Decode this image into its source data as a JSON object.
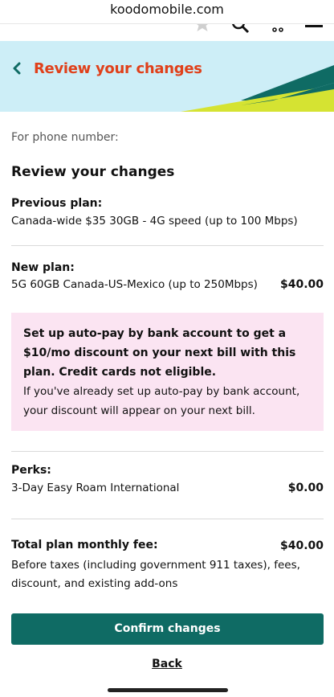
{
  "browser": {
    "url": "koodomobile.com"
  },
  "nav": {
    "icons": [
      "star-icon",
      "search-icon",
      "cart-icon",
      "menu-icon"
    ]
  },
  "header": {
    "title": "Review your changes",
    "back_icon": "chevron-left-icon"
  },
  "phone": {
    "label": "For phone number:"
  },
  "review": {
    "title": "Review your changes"
  },
  "previous_plan": {
    "label": "Previous plan:",
    "description": "Canada-wide $35 30GB - 4G speed (up to 100 Mbps)"
  },
  "new_plan": {
    "label": "New plan:",
    "description": "5G 60GB Canada-US-Mexico (up to 250Mbps)",
    "price": "$40.00"
  },
  "promo": {
    "line1": "Set up auto-pay by bank account to get a",
    "line2": "$10/mo discount on your next bill with this",
    "line3": "plan. Credit cards not eligible.",
    "line4": "If you've already set up auto-pay by bank account,",
    "line5": "your discount will appear on your next bill."
  },
  "perks": {
    "label": "Perks:",
    "item": "3-Day Easy Roam International",
    "price": "$0.00"
  },
  "total": {
    "label": "Total plan monthly fee:",
    "price": "$40.00",
    "note_line1": "Before taxes (including government 911 taxes), fees,",
    "note_line2": "discount, and existing add-ons"
  },
  "actions": {
    "confirm_label": "Confirm changes",
    "back_label": "Back"
  },
  "colors": {
    "brand_teal": "#0f6b64",
    "title_orange": "#e0401a",
    "banner_bg": "#cdeef7",
    "promo_bg": "#fbe4f2",
    "banner_lime": "#d5e332"
  }
}
